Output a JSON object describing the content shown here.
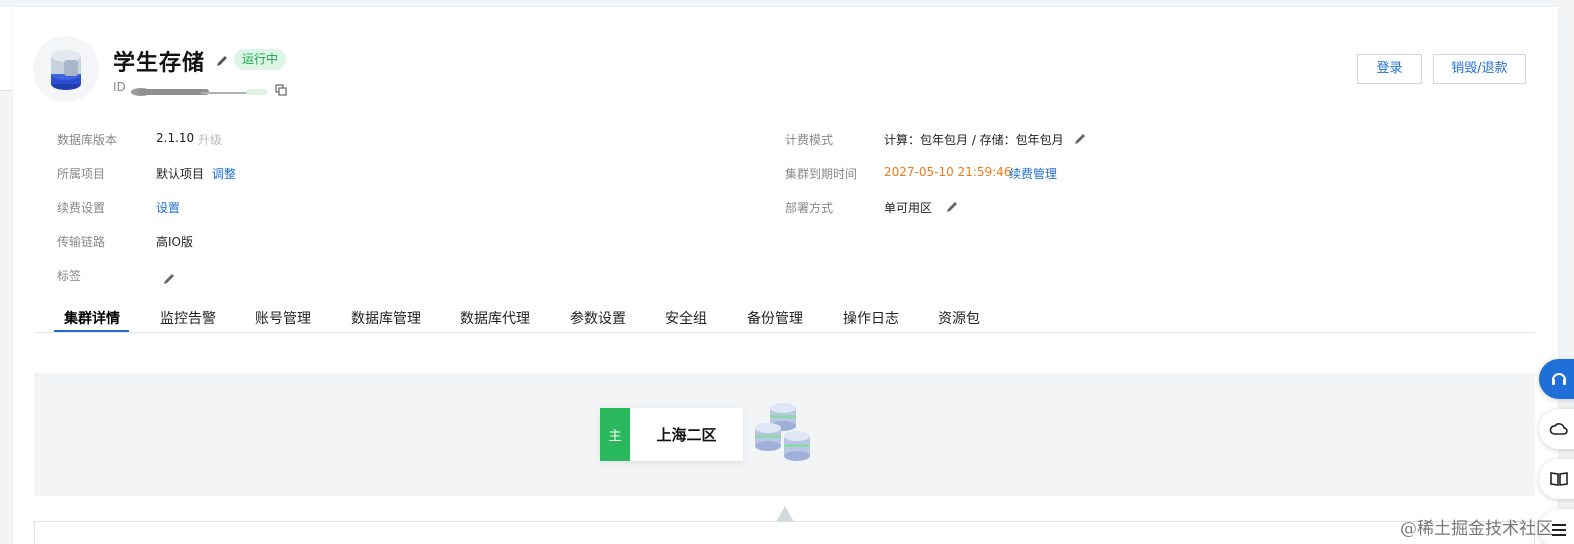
{
  "header": {
    "title": "学生存储",
    "status": "运行中",
    "id_label": "ID",
    "logo_icon": "database-stack-icon",
    "edit_icon": "pencil-icon",
    "copy_icon": "copy-icon"
  },
  "actions": {
    "login": "登录",
    "destroy": "销毁/退款"
  },
  "info": {
    "db_version_label": "数据库版本",
    "db_version": "2.1.10",
    "upgrade": "升级",
    "project_label": "所属项目",
    "project": "默认项目",
    "adjust": "调整",
    "renew_label": "续费设置",
    "renew_set": "设置",
    "link_label": "传输链路",
    "link_value": "高IO版",
    "tag_label": "标签",
    "billing_label": "计费模式",
    "billing_value": "计算：包年包月 / 存储：包年包月",
    "expire_label": "集群到期时间",
    "expire_value": "2027-05-10 21:59:46",
    "renew_manage": "续费管理",
    "deploy_label": "部署方式",
    "deploy_value": "单可用区"
  },
  "tabs": [
    {
      "label": "集群详情"
    },
    {
      "label": "监控告警"
    },
    {
      "label": "账号管理"
    },
    {
      "label": "数据库管理"
    },
    {
      "label": "数据库代理"
    },
    {
      "label": "参数设置"
    },
    {
      "label": "安全组"
    },
    {
      "label": "备份管理"
    },
    {
      "label": "操作日志"
    },
    {
      "label": "资源包"
    }
  ],
  "topology": {
    "role_tag": "主",
    "region": "上海二区",
    "node_icon": "database-cluster-icon"
  },
  "side_tools": [
    "headset-icon",
    "cloud-icon",
    "book-icon",
    "list-icon"
  ],
  "watermark": "@稀土掘金技术社区",
  "colors": {
    "primary": "#1f6fd8",
    "status_green": "#1aa552",
    "expire_orange": "#f07a1a",
    "role_green": "#29b85c"
  }
}
